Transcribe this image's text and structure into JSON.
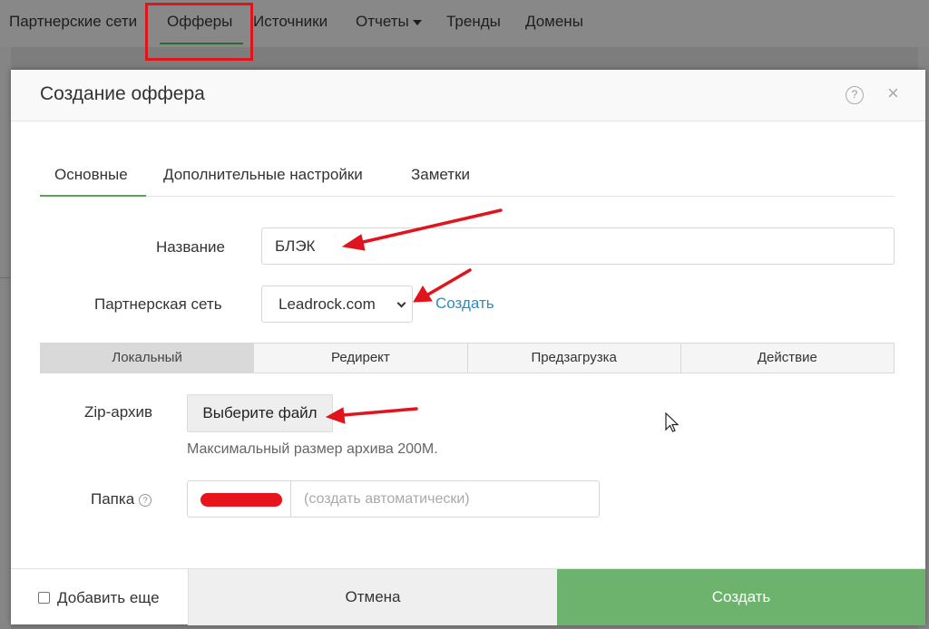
{
  "nav": {
    "items": [
      "Партнерские сети",
      "Офферы",
      "Источники",
      "Отчеты",
      "Тренды",
      "Домены"
    ],
    "active": "Офферы"
  },
  "modal": {
    "title": "Создание оффера",
    "help_glyph": "?",
    "close_glyph": "×",
    "tabs": [
      "Основные",
      "Дополнительные настройки",
      "Заметки"
    ],
    "active_tab": "Основные",
    "form": {
      "name_label": "Название",
      "name_value": "БЛЭК",
      "network_label": "Партнерская сеть",
      "network_selected": "Leadrock.com",
      "network_create_link": "Создать",
      "modes": [
        "Локальный",
        "Редирект",
        "Предзагрузка",
        "Действие"
      ],
      "active_mode": "Локальный",
      "zip_label": "Zip-архив",
      "file_button": "Выберите файл",
      "zip_hint": "Максимальный размер архива 200M.",
      "folder_label": "Папка",
      "folder_help_glyph": "?",
      "folder_placeholder": "(создать автоматически)"
    },
    "footer": {
      "add_more_label": "Добавить еще",
      "cancel_label": "Отмена",
      "create_label": "Создать"
    }
  },
  "colors": {
    "annotation_red": "#e0141c",
    "primary_green": "#6db36d",
    "link_blue": "#2c8bc4"
  }
}
